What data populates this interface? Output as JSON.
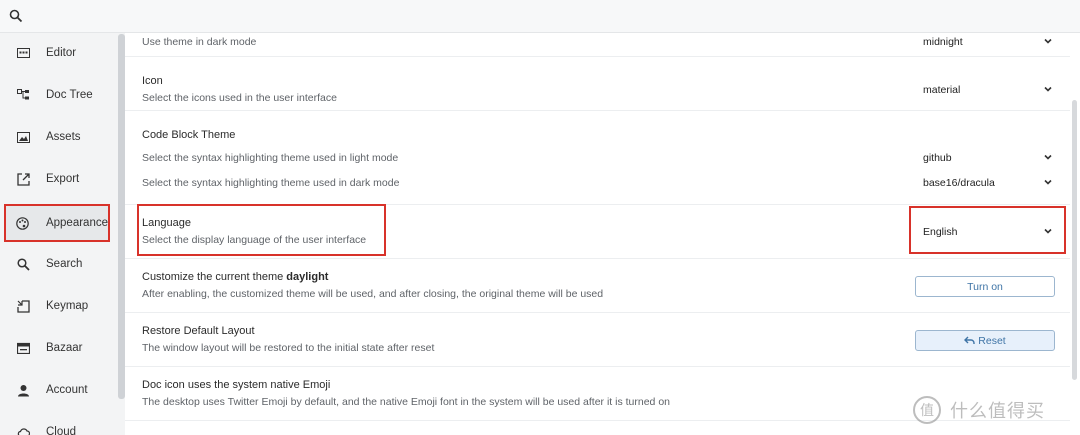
{
  "nav": {
    "items": [
      {
        "label": "Editor",
        "icon": "editor-icon"
      },
      {
        "label": "Doc Tree",
        "icon": "doc-tree-icon"
      },
      {
        "label": "Assets",
        "icon": "image-icon"
      },
      {
        "label": "Export",
        "icon": "export-icon"
      },
      {
        "label": "Appearance",
        "icon": "palette-icon"
      },
      {
        "label": "Search",
        "icon": "search-icon"
      },
      {
        "label": "Keymap",
        "icon": "keyboard-icon"
      },
      {
        "label": "Bazaar",
        "icon": "store-icon"
      },
      {
        "label": "Account",
        "icon": "user-icon"
      },
      {
        "label": "Cloud",
        "icon": "cloud-icon"
      }
    ],
    "active": "Appearance"
  },
  "settings": {
    "dark_mode": {
      "desc": "Use theme in dark mode",
      "value": "midnight"
    },
    "icon": {
      "label": "Icon",
      "desc": "Select the icons used in the user interface",
      "value": "material"
    },
    "code_block": {
      "label": "Code Block Theme",
      "light_desc": "Select the syntax highlighting theme used in light mode",
      "light_value": "github",
      "dark_desc": "Select the syntax highlighting theme used in dark mode",
      "dark_value": "base16/dracula"
    },
    "language": {
      "label": "Language",
      "desc": "Select the display language of the user interface",
      "value": "English"
    },
    "customize": {
      "label_prefix": "Customize the current theme ",
      "label_theme": "daylight",
      "desc": "After enabling, the customized theme will be used, and after closing, the original theme will be used",
      "button": "Turn on"
    },
    "restore": {
      "label": "Restore Default Layout",
      "desc": "The window layout will be restored to the initial state after reset",
      "button": "Reset"
    },
    "emoji": {
      "label": "Doc icon uses the system native Emoji",
      "desc": "The desktop uses Twitter Emoji by default, and the native Emoji font in the system will be used after it is turned on"
    }
  },
  "watermark": {
    "text": "什么值得买"
  },
  "colors": {
    "highlight": "#d8322a",
    "accent": "#3f74a6"
  }
}
